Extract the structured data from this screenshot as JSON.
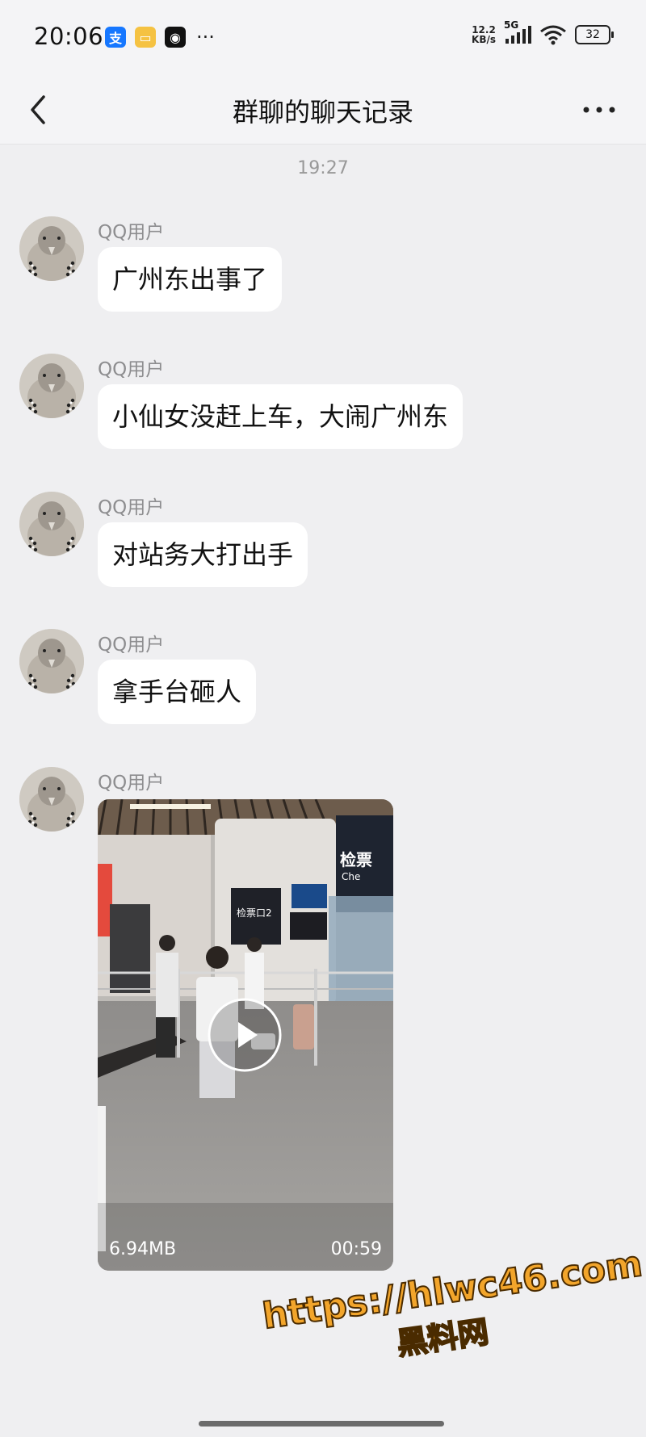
{
  "status_bar": {
    "time": "20:06",
    "net_speed_value": "12.2",
    "net_speed_unit": "KB/s",
    "network": "5G",
    "battery": "32",
    "more_dots": "···"
  },
  "header": {
    "title": "群聊的聊天记录"
  },
  "chat": {
    "timestamp": "19:27",
    "messages": [
      {
        "sender": "QQ用户",
        "text": "广州东出事了"
      },
      {
        "sender": "QQ用户",
        "text": "小仙女没赶上车，大闹广州东"
      },
      {
        "sender": "QQ用户",
        "text": "对站务大打出手"
      },
      {
        "sender": "QQ用户",
        "text": "拿手台砸人"
      },
      {
        "sender": "QQ用户",
        "video": {
          "size": "6.94MB",
          "duration": "00:59"
        }
      }
    ]
  },
  "watermark": {
    "url": "https://hlwc46.com",
    "name": "黑料网"
  },
  "colors": {
    "background": "#efeff1",
    "bubble": "#ffffff",
    "watermark": "#f2a52b"
  }
}
